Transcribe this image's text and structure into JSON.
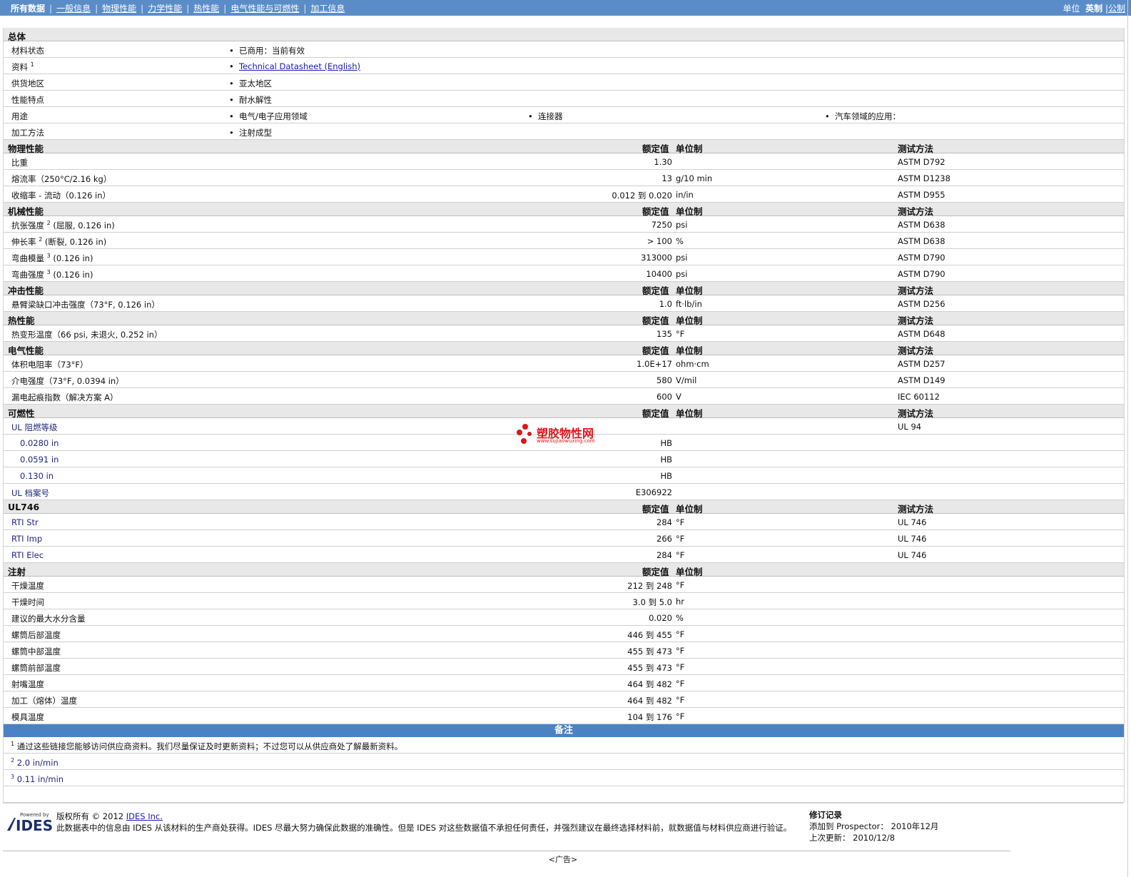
{
  "nav": {
    "items": [
      "所有数据",
      "一般信息",
      "物理性能",
      "力学性能",
      "热性能",
      "电气性能与可燃性",
      "加工信息"
    ],
    "units_label": "单位",
    "unit_imperial": "英制",
    "unit_metric": "公制"
  },
  "general": {
    "title": "总体",
    "status_label": "材料状态",
    "status_value": "已商用：当前有效",
    "docs_label": "资料",
    "docs_sup": "1",
    "docs_link": "Technical Datasheet (English)",
    "region_label": "供货地区",
    "region_value": "亚太地区",
    "feature_label": "性能特点",
    "feature_value": "耐水解性",
    "use_label": "用途",
    "use_values": [
      "电气/电子应用领域",
      "连接器",
      "汽车领域的应用："
    ],
    "process_label": "加工方法",
    "process_value": "注射成型"
  },
  "headers": {
    "nominal": "额定值",
    "unit": "单位制",
    "method": "测试方法"
  },
  "physical": {
    "title": "物理性能",
    "rows": [
      {
        "label": "比重",
        "value": "1.30",
        "unit": "",
        "method": "ASTM D792"
      },
      {
        "label": "熔流率（250°C/2.16 kg）",
        "value": "13",
        "unit": "g/10 min",
        "method": "ASTM D1238"
      },
      {
        "label": "收缩率 - 流动（0.126 in）",
        "value": "0.012 到  0.020",
        "unit": "in/in",
        "method": "ASTM D955"
      }
    ]
  },
  "mechanical": {
    "title": "机械性能",
    "rows": [
      {
        "label": "抗张强度",
        "sup": "2",
        "cond": "(屈服, 0.126 in)",
        "value": "7250",
        "unit": "psi",
        "method": "ASTM D638"
      },
      {
        "label": "伸长率",
        "sup": "2",
        "cond": "(断裂, 0.126 in)",
        "value": "> 100",
        "unit": "%",
        "method": "ASTM D638"
      },
      {
        "label": "弯曲模量",
        "sup": "3",
        "cond": "(0.126 in)",
        "value": "313000",
        "unit": "psi",
        "method": "ASTM D790"
      },
      {
        "label": "弯曲强度",
        "sup": "3",
        "cond": "(0.126 in)",
        "value": "10400",
        "unit": "psi",
        "method": "ASTM D790"
      }
    ]
  },
  "impact": {
    "title": "冲击性能",
    "rows": [
      {
        "label": "悬臂梁缺口冲击强度（73°F, 0.126 in）",
        "value": "1.0",
        "unit": "ft·lb/in",
        "method": "ASTM D256"
      }
    ]
  },
  "thermal": {
    "title": "热性能",
    "rows": [
      {
        "label": "热变形温度（66 psi, 未退火, 0.252 in）",
        "value": "135",
        "unit": "°F",
        "method": "ASTM D648"
      }
    ]
  },
  "electrical": {
    "title": "电气性能",
    "rows": [
      {
        "label": "体积电阻率（73°F）",
        "value": "1.0E+17",
        "unit": "ohm·cm",
        "method": "ASTM D257"
      },
      {
        "label": "介电强度（73°F, 0.0394 in）",
        "value": "580",
        "unit": "V/mil",
        "method": "ASTM D149"
      },
      {
        "label": "漏电起痕指数（解决方案 A）",
        "value": "600",
        "unit": "V",
        "method": "IEC 60112"
      }
    ]
  },
  "flammability": {
    "title": "可燃性",
    "ul_label": "UL 阻燃等级",
    "ul_method": "UL 94",
    "ul_rows": [
      {
        "label": "0.0280 in",
        "value": "HB"
      },
      {
        "label": "0.0591 in",
        "value": "HB"
      },
      {
        "label": "0.130 in",
        "value": "HB"
      }
    ],
    "file_label": "UL 档案号",
    "file_value": "E306922"
  },
  "ul746": {
    "title": "UL746",
    "rows": [
      {
        "label": "RTI Str",
        "value": "284",
        "unit": "°F",
        "method": "UL 746"
      },
      {
        "label": "RTI Imp",
        "value": "266",
        "unit": "°F",
        "method": "UL 746"
      },
      {
        "label": "RTI Elec",
        "value": "284",
        "unit": "°F",
        "method": "UL 746"
      }
    ]
  },
  "injection": {
    "title": "注射",
    "rows": [
      {
        "label": "干燥温度",
        "value": "212 到  248",
        "unit": "°F"
      },
      {
        "label": "干燥时间",
        "value": "3.0 到  5.0",
        "unit": "hr"
      },
      {
        "label": "建议的最大水分含量",
        "value": "0.020",
        "unit": "%"
      },
      {
        "label": "螺筒后部温度",
        "value": "446 到  455",
        "unit": "°F"
      },
      {
        "label": "螺筒中部温度",
        "value": "455 到  473",
        "unit": "°F"
      },
      {
        "label": "螺筒前部温度",
        "value": "455 到  473",
        "unit": "°F"
      },
      {
        "label": "射嘴温度",
        "value": "464 到  482",
        "unit": "°F"
      },
      {
        "label": "加工（熔体）温度",
        "value": "464 到  482",
        "unit": "°F"
      },
      {
        "label": "模具温度",
        "value": "104 到  176",
        "unit": "°F"
      }
    ]
  },
  "notes": {
    "title": "备注",
    "items": [
      {
        "sup": "1",
        "text": "通过这些链接您能够访问供应商资料。我们尽量保证及时更新资料；不过您可以从供应商处了解最新资料。"
      },
      {
        "sup": "2",
        "text": "2.0 in/min"
      },
      {
        "sup": "3",
        "text": "0.11 in/min"
      }
    ]
  },
  "footer": {
    "powered_by": "Powered by",
    "logo_text": "IDES",
    "copyright": "版权所有 © 2012",
    "company_link": "IDES Inc.",
    "disclaimer": "此数据表中的信息由  IDES 从该材料的生产商处获得。IDES 尽最大努力确保此数据的准确性。但是  IDES 对这些数据值不承担任何责任，并强烈建议在最终选择材料前，就数据值与材料供应商进行验证。",
    "revision_title": "修订记录",
    "added_label": "添加到  Prospector：",
    "added_value": "2010年12月",
    "updated_label": "上次更新：",
    "updated_value": "2010/12/8",
    "ad": "<广告>"
  },
  "watermark": {
    "title": "塑胶物性网",
    "url": "www.sujiaowuxing.com"
  }
}
